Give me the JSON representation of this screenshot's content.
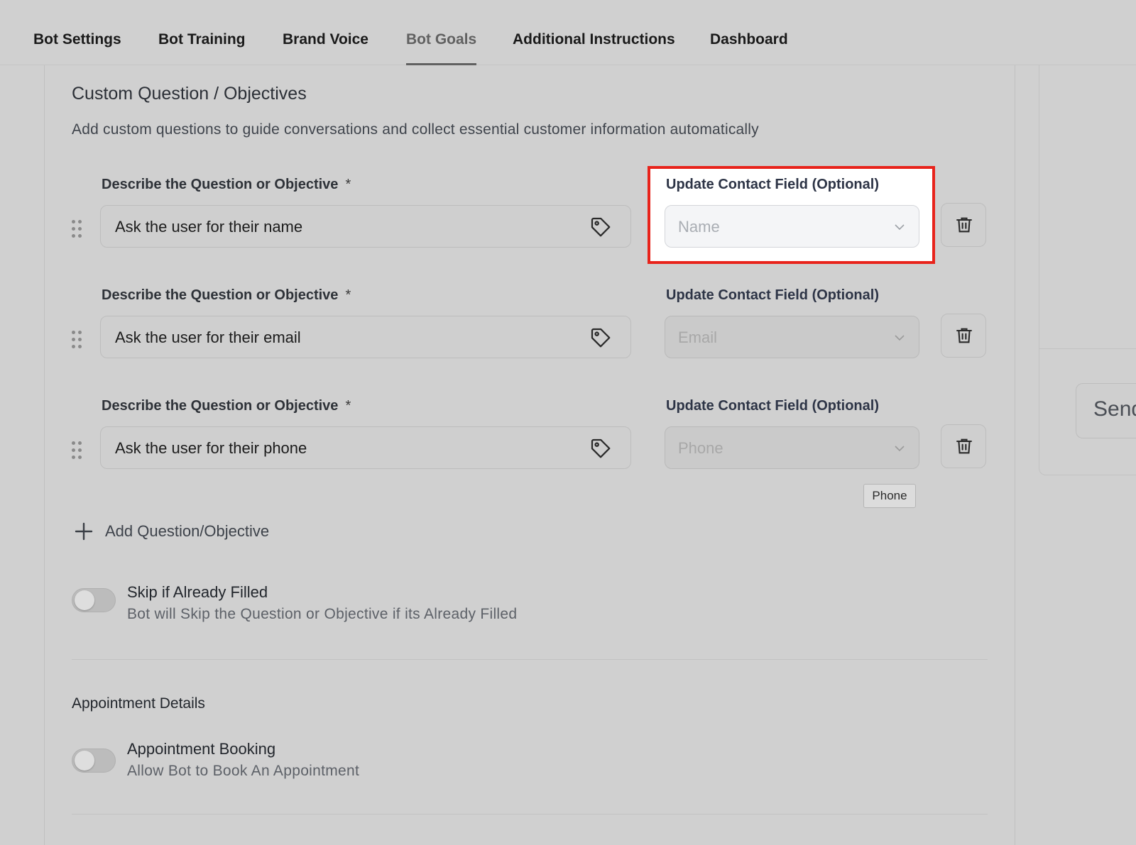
{
  "tabs": [
    {
      "label": "Bot Settings",
      "active": false
    },
    {
      "label": "Bot Training",
      "active": false
    },
    {
      "label": "Brand Voice",
      "active": false
    },
    {
      "label": "Bot Goals",
      "active": true
    },
    {
      "label": "Additional Instructions",
      "active": false
    },
    {
      "label": "Dashboard",
      "active": false
    }
  ],
  "section": {
    "title": "Custom Question / Objectives",
    "description": "Add custom questions to guide conversations and collect essential customer information automatically"
  },
  "questions": [
    {
      "label": "Describe the Question or Objective",
      "required_mark": "*",
      "value": "Ask the user for their name",
      "contact_label": "Update Contact Field (Optional)",
      "contact_placeholder": "Name",
      "highlighted": true
    },
    {
      "label": "Describe the Question or Objective",
      "required_mark": "*",
      "value": "Ask the user for their email",
      "contact_label": "Update Contact Field (Optional)",
      "contact_placeholder": "Email",
      "highlighted": false
    },
    {
      "label": "Describe the Question or Objective",
      "required_mark": "*",
      "value": "Ask the user for their phone",
      "contact_label": "Update Contact Field (Optional)",
      "contact_placeholder": "Phone",
      "highlighted": false
    }
  ],
  "tooltip": {
    "text": "Phone"
  },
  "add_question": {
    "label": "Add Question/Objective"
  },
  "skip_toggle": {
    "title": "Skip if Already Filled",
    "subtitle": "Bot will Skip the Question or Objective if its Already Filled",
    "on": false
  },
  "appointment": {
    "heading": "Appointment Details",
    "toggle_title": "Appointment Booking",
    "toggle_subtitle": "Allow Bot to Book An Appointment",
    "on": false
  },
  "side_panel": {
    "send_label": "Send"
  },
  "colors": {
    "background": "#d0d0d0",
    "highlight_border": "#e8231b",
    "active_tab": "#616161"
  },
  "icons": [
    "drag-handle-icon",
    "tag-icon",
    "chevron-down-icon",
    "trash-icon",
    "plus-icon"
  ]
}
